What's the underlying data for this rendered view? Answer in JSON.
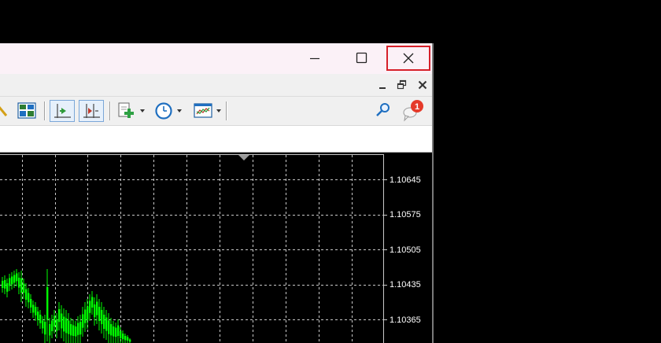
{
  "window": {
    "controls": [
      "minimize",
      "maximize",
      "close"
    ]
  },
  "toolbar": {
    "icons": [
      "zoom-icon",
      "tile-windows-icon",
      "auto-scroll-icon",
      "chart-shift-icon",
      "indicators-icon",
      "periods-icon",
      "templates-icon",
      "search-icon",
      "notifications-icon"
    ],
    "notification_count": "1"
  },
  "chart": {
    "price_labels": [
      "1.10645",
      "1.10575",
      "1.10505",
      "1.10435",
      "1.10365"
    ],
    "candle_color": "#00ff00",
    "grid_color": "#c8c8c8",
    "background": "#000000"
  },
  "colors": {
    "close_highlight": "#d6202a",
    "titlebar": "#fbf1f7",
    "notification_badge": "#e53a2a"
  }
}
